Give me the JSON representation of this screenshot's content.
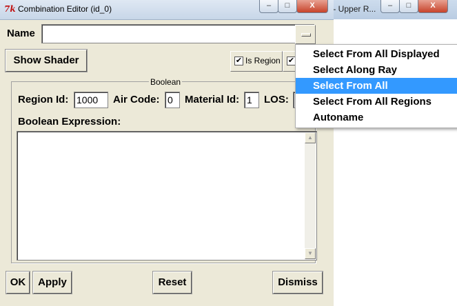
{
  "background_window": {
    "title": "et.g - Upper R..."
  },
  "window": {
    "title": "Combination Editor (id_0)",
    "controls": {
      "minimize": "–",
      "maximize": "□",
      "close": "X"
    }
  },
  "name_row": {
    "label": "Name",
    "value": ""
  },
  "show_shader_label": "Show Shader",
  "is_region": {
    "label": "Is Region",
    "checked": true
  },
  "group_title": "Boolean",
  "fields": {
    "region_id": {
      "label": "Region Id:",
      "value": "1000"
    },
    "air_code": {
      "label": "Air Code:",
      "value": "0"
    },
    "material_id": {
      "label": "Material Id:",
      "value": "1"
    },
    "los": {
      "label": "LOS:",
      "value": ""
    }
  },
  "boolean_expression": {
    "label": "Boolean Expression:",
    "value": ""
  },
  "buttons": {
    "ok": "OK",
    "apply": "Apply",
    "reset": "Reset",
    "dismiss": "Dismiss"
  },
  "menu": {
    "items": [
      {
        "label": "Select From All Displayed",
        "selected": false
      },
      {
        "label": "Select Along Ray",
        "selected": false
      },
      {
        "label": "Select From All",
        "selected": true
      },
      {
        "label": "Select From All Regions",
        "selected": false
      },
      {
        "label": "Autoname",
        "selected": false
      }
    ]
  },
  "colors": {
    "menu_highlight": "#3399ff",
    "window_bg": "#ece9d8"
  }
}
